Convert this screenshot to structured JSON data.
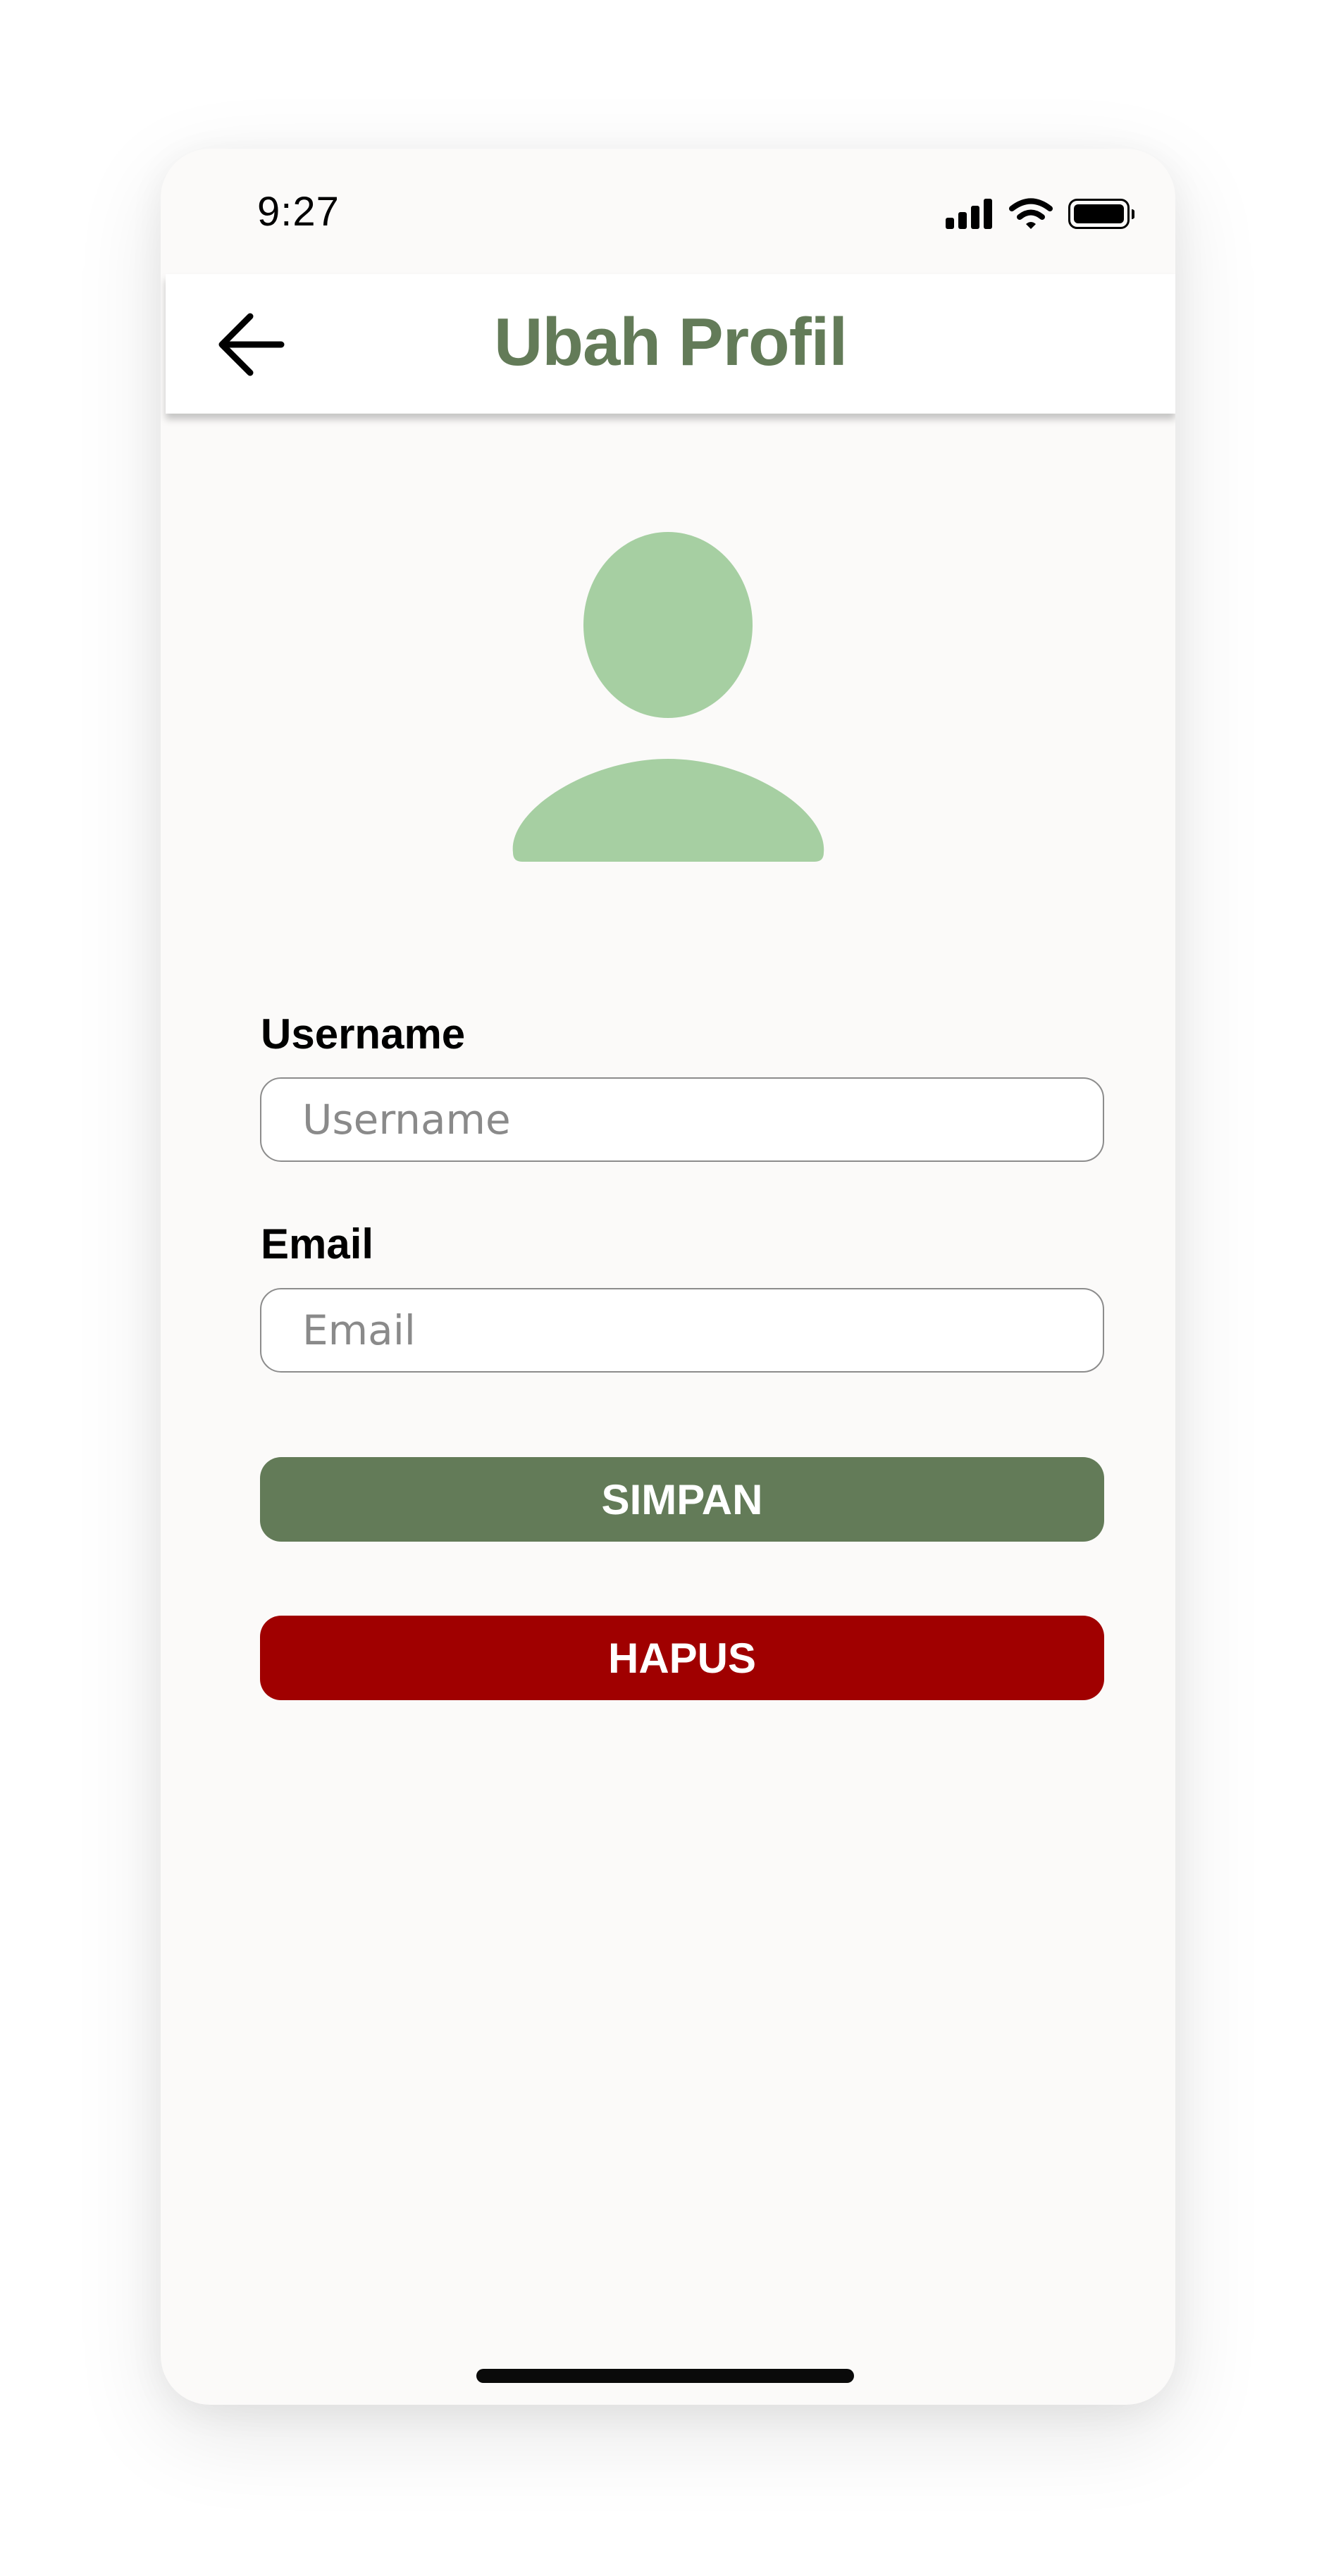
{
  "status_bar": {
    "time": "9:27"
  },
  "header": {
    "title": "Ubah Profil",
    "back_icon": "arrow-left-icon"
  },
  "avatar": {
    "icon": "user-placeholder-icon",
    "color": "#a6cfa2"
  },
  "form": {
    "username": {
      "label": "Username",
      "placeholder": "Username",
      "value": ""
    },
    "email": {
      "label": "Email",
      "placeholder": "Email",
      "value": ""
    }
  },
  "actions": {
    "save_label": "SIMPAN",
    "delete_label": "HAPUS"
  },
  "colors": {
    "primary": "#637b58",
    "danger": "#a00000",
    "background": "#fbfaf9"
  }
}
